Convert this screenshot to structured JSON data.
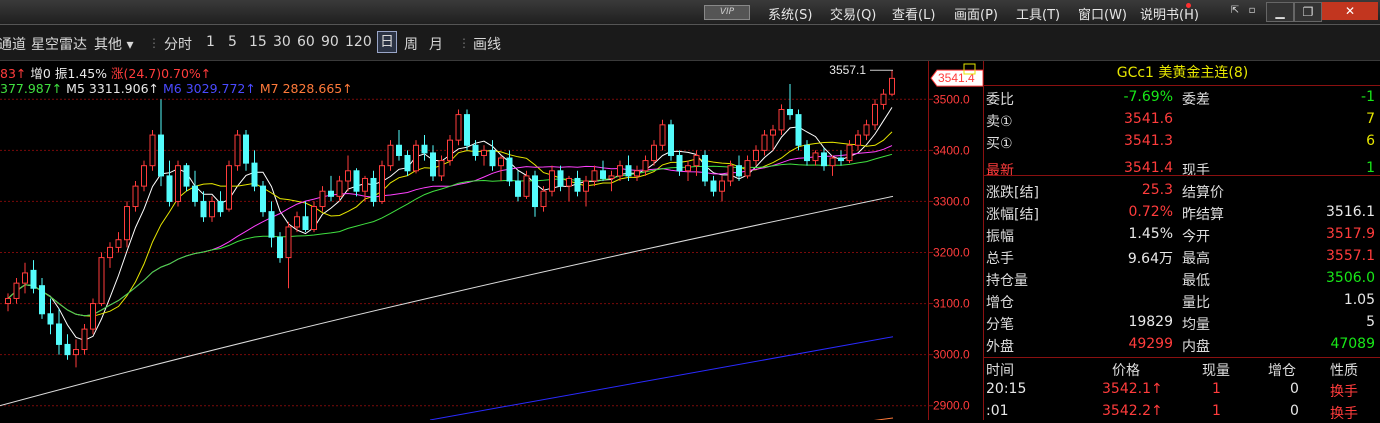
{
  "menubar": {
    "vip": "VIP",
    "items": [
      "系统(S)",
      "交易(Q)",
      "查看(L)",
      "画面(P)",
      "工具(T)",
      "窗口(W)",
      "说明书(H)"
    ]
  },
  "toolbar": {
    "items": [
      "通道",
      "星空雷达",
      "其他 ▾",
      "分时",
      "1",
      "5",
      "15",
      "30",
      "60",
      "90",
      "120",
      "日",
      "周",
      "月",
      "画线"
    ]
  },
  "legend": {
    "line1": {
      "a": "83↑",
      "b": "增0",
      "c": "振1.45%",
      "d": "涨(24.7)0.70%↑"
    },
    "ma": {
      "m4": "377.987↑",
      "m5_label": "M5",
      "m5": "3311.906↑",
      "m6_label": "M6",
      "m6": "3029.772↑",
      "m7_label": "M7",
      "m7": "2828.665↑"
    }
  },
  "chart_labels": {
    "high_label": "3557.1",
    "last_price": "3541.4"
  },
  "axis": {
    "ticks": [
      "3500.0",
      "3400.0",
      "3300.0",
      "3200.0",
      "3100.0",
      "3000.0",
      "2900.0"
    ]
  },
  "colors": {
    "up": "#ff3c3c",
    "down": "#54fcfc",
    "ma4": "#ffffff",
    "ma5": "#e6e600",
    "ma6": "#ff40ff",
    "ma7": "#40e040",
    "ma8": "#dcdcdc",
    "ma9": "#2a2aff"
  },
  "panel": {
    "title": "GCc1 美黄金主连(8)",
    "rows": [
      {
        "l": "委比",
        "v": "-7.69%",
        "vc": "green",
        "l2": "委差",
        "v2": "-1",
        "v2c": "green"
      },
      {
        "l": "卖①",
        "v": "3541.6",
        "vc": "red",
        "l2": "",
        "v2": "7",
        "v2c": "yellow"
      },
      {
        "l": "买①",
        "v": "3541.3",
        "vc": "red",
        "l2": "",
        "v2": "6",
        "v2c": "yellow"
      },
      {
        "l": "最新",
        "v": "3541.4",
        "vc": "red",
        "l2": "现手",
        "v2": "1",
        "v2c": "green",
        "lc": "red"
      },
      {
        "l": "涨跌[结]",
        "v": "25.3",
        "vc": "red",
        "l2": "结算价",
        "v2": "",
        "v2c": "white"
      },
      {
        "l": "涨幅[结]",
        "v": "0.72%",
        "vc": "red",
        "l2": "昨结算",
        "v2": "3516.1",
        "v2c": "white"
      },
      {
        "l": "振幅",
        "v": "1.45%",
        "vc": "white",
        "l2": "今开",
        "v2": "3517.9",
        "v2c": "red"
      },
      {
        "l": "总手",
        "v": "9.64万",
        "vc": "white",
        "l2": "最高",
        "v2": "3557.1",
        "v2c": "red"
      },
      {
        "l": "持仓量",
        "v": "",
        "vc": "white",
        "l2": "最低",
        "v2": "3506.0",
        "v2c": "green"
      },
      {
        "l": "增仓",
        "v": "",
        "vc": "white",
        "l2": "量比",
        "v2": "1.05",
        "v2c": "white"
      },
      {
        "l": "分笔",
        "v": "19829",
        "vc": "white",
        "l2": "均量",
        "v2": "5",
        "v2c": "white"
      },
      {
        "l": "外盘",
        "v": "49299",
        "vc": "red",
        "l2": "内盘",
        "v2": "47089",
        "v2c": "green"
      }
    ],
    "ticks_header": [
      "时间",
      "价格",
      "现量",
      "增仓",
      "性质"
    ],
    "ticks": [
      {
        "t": "20:15",
        "p": "3542.1↑",
        "q": "1",
        "oi": "0",
        "k": "换手"
      },
      {
        "t": ":01",
        "p": "3542.2↑",
        "q": "1",
        "oi": "0",
        "k": "换手"
      }
    ]
  },
  "chart_data": {
    "type": "candlestick",
    "ylim": [
      2872,
      3575
    ],
    "price_ticks": [
      3500,
      3400,
      3300,
      3200,
      3100,
      3000,
      2900
    ],
    "candles": [
      [
        3100,
        3120,
        3085,
        3110
      ],
      [
        3110,
        3150,
        3100,
        3140
      ],
      [
        3140,
        3180,
        3120,
        3160
      ],
      [
        3165,
        3185,
        3120,
        3130
      ],
      [
        3135,
        3150,
        3070,
        3080
      ],
      [
        3080,
        3110,
        3040,
        3060
      ],
      [
        3060,
        3090,
        3000,
        3020
      ],
      [
        3020,
        3040,
        2990,
        3000
      ],
      [
        3000,
        3030,
        2975,
        3010
      ],
      [
        3010,
        3060,
        3000,
        3050
      ],
      [
        3050,
        3110,
        3040,
        3100
      ],
      [
        3100,
        3200,
        3095,
        3190
      ],
      [
        3190,
        3220,
        3170,
        3210
      ],
      [
        3210,
        3240,
        3200,
        3225
      ],
      [
        3225,
        3300,
        3210,
        3290
      ],
      [
        3290,
        3340,
        3280,
        3330
      ],
      [
        3330,
        3380,
        3320,
        3370
      ],
      [
        3370,
        3440,
        3360,
        3430
      ],
      [
        3430,
        3500,
        3330,
        3350
      ],
      [
        3350,
        3380,
        3290,
        3300
      ],
      [
        3300,
        3380,
        3290,
        3370
      ],
      [
        3370,
        3375,
        3320,
        3330
      ],
      [
        3330,
        3360,
        3290,
        3300
      ],
      [
        3300,
        3320,
        3260,
        3270
      ],
      [
        3270,
        3310,
        3260,
        3300
      ],
      [
        3300,
        3320,
        3270,
        3280
      ],
      [
        3285,
        3380,
        3280,
        3370
      ],
      [
        3370,
        3440,
        3360,
        3430
      ],
      [
        3430,
        3440,
        3360,
        3375
      ],
      [
        3375,
        3400,
        3320,
        3330
      ],
      [
        3330,
        3340,
        3270,
        3280
      ],
      [
        3280,
        3300,
        3210,
        3230
      ],
      [
        3230,
        3240,
        3180,
        3190
      ],
      [
        3190,
        3260,
        3130,
        3250
      ],
      [
        3250,
        3280,
        3240,
        3270
      ],
      [
        3270,
        3300,
        3240,
        3245
      ],
      [
        3245,
        3300,
        3240,
        3290
      ],
      [
        3290,
        3330,
        3280,
        3320
      ],
      [
        3320,
        3350,
        3300,
        3310
      ],
      [
        3310,
        3350,
        3300,
        3340
      ],
      [
        3340,
        3390,
        3320,
        3360
      ],
      [
        3360,
        3365,
        3310,
        3320
      ],
      [
        3320,
        3350,
        3300,
        3345
      ],
      [
        3345,
        3360,
        3290,
        3300
      ],
      [
        3300,
        3380,
        3295,
        3370
      ],
      [
        3370,
        3420,
        3360,
        3410
      ],
      [
        3410,
        3440,
        3380,
        3390
      ],
      [
        3390,
        3400,
        3350,
        3360
      ],
      [
        3360,
        3420,
        3355,
        3410
      ],
      [
        3410,
        3430,
        3380,
        3395
      ],
      [
        3395,
        3410,
        3340,
        3350
      ],
      [
        3350,
        3390,
        3340,
        3380
      ],
      [
        3380,
        3430,
        3370,
        3420
      ],
      [
        3420,
        3480,
        3410,
        3470
      ],
      [
        3470,
        3480,
        3400,
        3410
      ],
      [
        3410,
        3420,
        3380,
        3390
      ],
      [
        3390,
        3410,
        3370,
        3400
      ],
      [
        3400,
        3420,
        3360,
        3370
      ],
      [
        3370,
        3390,
        3340,
        3385
      ],
      [
        3385,
        3400,
        3330,
        3340
      ],
      [
        3340,
        3360,
        3300,
        3310
      ],
      [
        3310,
        3360,
        3305,
        3350
      ],
      [
        3350,
        3360,
        3270,
        3290
      ],
      [
        3290,
        3330,
        3280,
        3320
      ],
      [
        3320,
        3370,
        3310,
        3360
      ],
      [
        3360,
        3370,
        3320,
        3330
      ],
      [
        3330,
        3350,
        3300,
        3345
      ],
      [
        3345,
        3360,
        3310,
        3320
      ],
      [
        3320,
        3350,
        3290,
        3340
      ],
      [
        3340,
        3370,
        3330,
        3360
      ],
      [
        3360,
        3380,
        3340,
        3345
      ],
      [
        3345,
        3360,
        3320,
        3350
      ],
      [
        3350,
        3380,
        3340,
        3370
      ],
      [
        3370,
        3390,
        3340,
        3350
      ],
      [
        3350,
        3370,
        3340,
        3360
      ],
      [
        3360,
        3390,
        3350,
        3380
      ],
      [
        3380,
        3420,
        3370,
        3410
      ],
      [
        3410,
        3460,
        3400,
        3450
      ],
      [
        3450,
        3460,
        3380,
        3390
      ],
      [
        3390,
        3400,
        3350,
        3360
      ],
      [
        3360,
        3380,
        3340,
        3370
      ],
      [
        3370,
        3400,
        3350,
        3390
      ],
      [
        3390,
        3400,
        3330,
        3340
      ],
      [
        3340,
        3350,
        3310,
        3320
      ],
      [
        3320,
        3350,
        3300,
        3340
      ],
      [
        3340,
        3380,
        3330,
        3370
      ],
      [
        3370,
        3390,
        3340,
        3350
      ],
      [
        3350,
        3390,
        3345,
        3380
      ],
      [
        3380,
        3410,
        3370,
        3400
      ],
      [
        3400,
        3440,
        3390,
        3430
      ],
      [
        3430,
        3450,
        3400,
        3440
      ],
      [
        3440,
        3490,
        3430,
        3480
      ],
      [
        3480,
        3530,
        3460,
        3470
      ],
      [
        3470,
        3480,
        3400,
        3410
      ],
      [
        3410,
        3420,
        3370,
        3380
      ],
      [
        3380,
        3400,
        3370,
        3395
      ],
      [
        3395,
        3405,
        3360,
        3370
      ],
      [
        3370,
        3390,
        3350,
        3385
      ],
      [
        3385,
        3400,
        3370,
        3380
      ],
      [
        3380,
        3420,
        3375,
        3410
      ],
      [
        3410,
        3440,
        3400,
        3430
      ],
      [
        3430,
        3460,
        3420,
        3450
      ],
      [
        3450,
        3500,
        3440,
        3490
      ],
      [
        3490,
        3520,
        3480,
        3510
      ],
      [
        3510,
        3557,
        3506,
        3541
      ]
    ]
  }
}
